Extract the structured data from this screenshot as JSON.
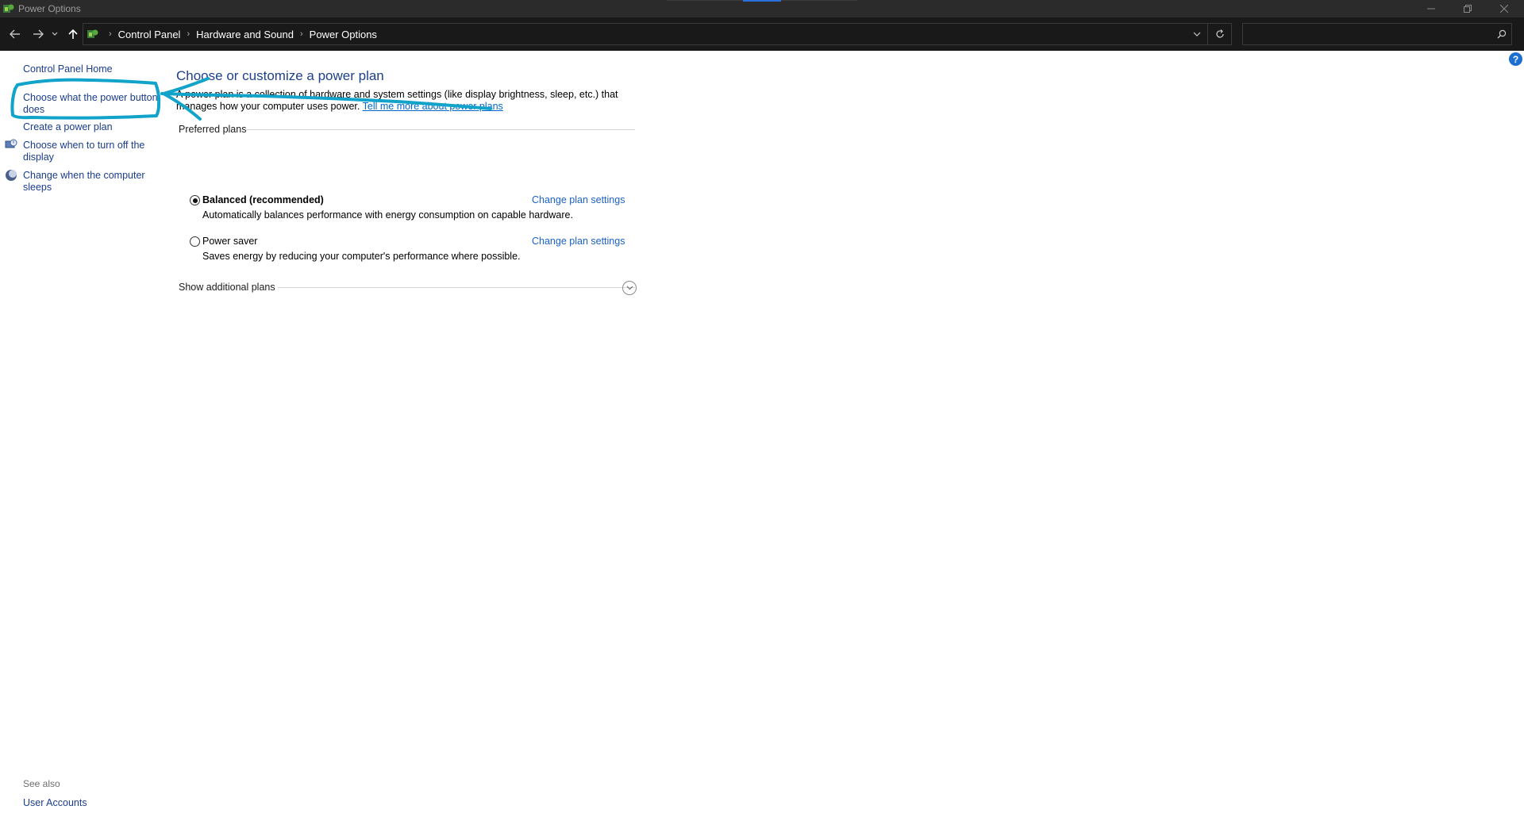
{
  "window": {
    "title": "Power Options",
    "controls": {
      "minimize": "minimize-icon",
      "restore": "restore-icon",
      "close": "close-icon"
    }
  },
  "address_bar": {
    "breadcrumbs": [
      "Control Panel",
      "Hardware and Sound",
      "Power Options"
    ],
    "search_placeholder": ""
  },
  "left_pane": {
    "home": "Control Panel Home",
    "links": [
      "Choose what the power button does",
      "Create a power plan",
      "Choose when to turn off the display",
      "Change when the computer sleeps"
    ],
    "see_also_label": "See also",
    "see_also_links": [
      "User Accounts"
    ]
  },
  "main": {
    "heading": "Choose or customize a power plan",
    "description": "A power plan is a collection of hardware and system settings (like display brightness, sleep, etc.) that manages how your computer uses power.",
    "more_link": "Tell me more about power plans",
    "preferred_label": "Preferred plans",
    "plans": [
      {
        "name": "Balanced (recommended)",
        "description": "Automatically balances performance with energy consumption on capable hardware.",
        "link": "Change plan settings",
        "selected": true
      },
      {
        "name": "Power saver",
        "description": "Saves energy by reducing your computer's performance where possible.",
        "link": "Change plan settings",
        "selected": false
      }
    ],
    "additional_label": "Show additional plans"
  },
  "colors": {
    "annotation": "#11a3c9",
    "link": "#1a3c8e",
    "heading": "#1e3f8a"
  }
}
